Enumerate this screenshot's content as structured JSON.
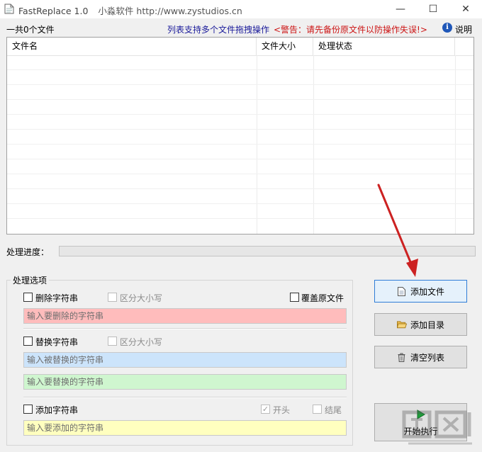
{
  "window": {
    "title": "FastReplace 1.0",
    "subtitle": "小淼软件 http://www.zystudios.cn",
    "controls": {
      "minimize": "—",
      "maximize": "☐",
      "close": "✕"
    }
  },
  "toolbar": {
    "file_count": "一共0个文件",
    "drag_hint": "列表支持多个文件拖拽操作",
    "warning": "<警告：请先备份原文件以防操作失误!>",
    "help_label": "说明",
    "help_icon": "i"
  },
  "file_list": {
    "columns": [
      "文件名",
      "文件大小",
      "处理状态"
    ],
    "rows": []
  },
  "progress": {
    "label": "处理进度：",
    "value": 0
  },
  "options": {
    "group_title": "处理选项",
    "delete": {
      "label": "删除字符串",
      "checked": false,
      "case_label": "区分大小写",
      "case_checked": false,
      "overwrite_label": "覆盖原文件",
      "overwrite_checked": false,
      "placeholder": "输入要删除的字符串"
    },
    "replace": {
      "label": "替换字符串",
      "checked": false,
      "case_label": "区分大小写",
      "case_checked": false,
      "find_placeholder": "输入被替换的字符串",
      "replace_placeholder": "输入要替换的字符串"
    },
    "add": {
      "label": "添加字符串",
      "checked": false,
      "start_label": "开头",
      "start_checked": true,
      "end_label": "结尾",
      "end_checked": false,
      "placeholder": "输入要添加的字符串"
    }
  },
  "buttons": {
    "add_file": "添加文件",
    "add_dir": "添加目录",
    "clear_list": "清空列表",
    "execute": "开始执行"
  },
  "colors": {
    "delete_field": "#ffbcbc",
    "find_field": "#cce4fb",
    "replace_field": "#cff6cf",
    "add_field": "#ffffbf",
    "annotation_arrow": "#cc2222",
    "warning_text": "#cc1414",
    "hint_text": "#1a1a9a"
  }
}
